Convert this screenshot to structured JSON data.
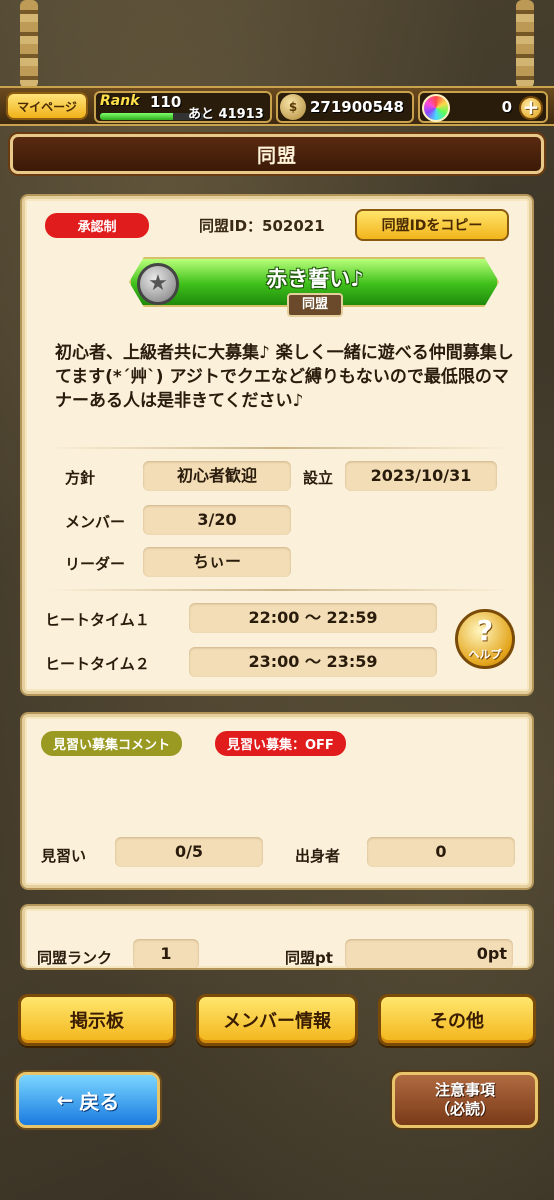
{
  "topbar": {
    "mypage_label": "マイページ",
    "rank_label": "Rank",
    "rank_value": "110",
    "rank_next": "あと 41913",
    "rank_progress": 0.7,
    "money_icon_text": "$",
    "money_value": "271900548",
    "gem_value": "0",
    "plus_label": "+"
  },
  "title": "同盟",
  "alliance": {
    "approval_badge": "承認制",
    "id_label": "同盟ID：502021",
    "copy_button": "同盟IDをコピー",
    "name": "赤き誓い♪",
    "tag": "同盟",
    "description": "初心者、上級者共に大募集♪ 楽しく一緒に遊べる仲間募集してます(*´艸`) アジトでクエなど縛りもないので最低限のマナーある人は是非きてください♪",
    "policy_label": "方針",
    "policy_value": "初心者歓迎",
    "founded_label": "設立",
    "founded_value": "2023/10/31",
    "members_label": "メンバー",
    "members_value": "3/20",
    "leader_label": "リーダー",
    "leader_value": "ちぃー",
    "heat1_label": "ヒートタイム１",
    "heat1_value": "22:00 ～ 22:59",
    "heat2_label": "ヒートタイム２",
    "heat2_value": "23:00 ～ 23:59",
    "help_q": "?",
    "help_label": "ヘルプ"
  },
  "apprentice": {
    "comment_badge": "見習い募集コメント",
    "recruit_badge": "見習い募集：OFF",
    "apprentice_label": "見習い",
    "apprentice_value": "0/5",
    "origin_label": "出身者",
    "origin_value": "0"
  },
  "rank_panel": {
    "rank_label": "同盟ランク",
    "rank_value": "1",
    "pt_label": "同盟pt",
    "pt_value": "0pt"
  },
  "buttons": {
    "board": "掲示板",
    "member_info": "メンバー情報",
    "other": "その他",
    "back": "戻る",
    "back_arrow": "←",
    "notice_line1": "注意事項",
    "notice_line2": "（必読）"
  },
  "colors": {
    "accent_red": "#e11c1c",
    "accent_yellow": "#f2b51a",
    "panel_bg": "#fbf1da",
    "banner_green": "#3fbf1a"
  }
}
